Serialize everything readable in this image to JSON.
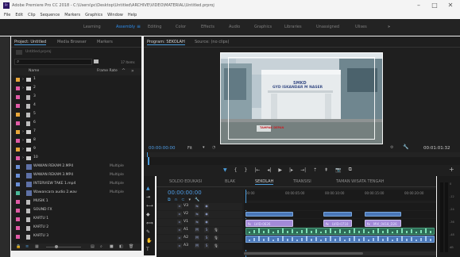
{
  "window": {
    "app_icon_label": "Pr",
    "title": "Adobe Premiere Pro CC 2018 - C:\\Users\\pc\\Desktop\\Untitled\\ARCHIVE\\VIDEO\\MATERIAL\\Untitled.prproj",
    "controls": [
      "–",
      "□",
      "✕"
    ]
  },
  "menu": [
    "File",
    "Edit",
    "Clip",
    "Sequence",
    "Markers",
    "Graphics",
    "Window",
    "Help"
  ],
  "workspaces": {
    "items": [
      "Learning",
      "Assembly",
      "Editing",
      "Color",
      "Effects",
      "Audio",
      "Graphics",
      "Libraries",
      "Unassigned",
      "Ulises"
    ],
    "active_index": 1,
    "more": "»"
  },
  "project_panel": {
    "tabs": [
      "Project: Untitled",
      "Media Browser",
      "Markers"
    ],
    "active_tab": 0,
    "path": "Untitled.prproj",
    "search_placeholder": "",
    "items_count": "17 Items",
    "columns": {
      "name": "Name",
      "frame_rate": "Frame Rate"
    },
    "rows": [
      {
        "kind": "bin",
        "color": "#e8a63a",
        "name": "1",
        "type": ""
      },
      {
        "kind": "bin",
        "color": "#e05aa6",
        "name": "2",
        "type": ""
      },
      {
        "kind": "seq",
        "color": "#e05aa6",
        "name": "3",
        "type": ""
      },
      {
        "kind": "seq",
        "color": "#e05aa6",
        "name": "4",
        "type": ""
      },
      {
        "kind": "seq",
        "color": "#e8a63a",
        "name": "5",
        "type": ""
      },
      {
        "kind": "seq",
        "color": "#e05aa6",
        "name": "6",
        "type": ""
      },
      {
        "kind": "bin",
        "color": "#e8a63a",
        "name": "7",
        "type": ""
      },
      {
        "kind": "bin",
        "color": "#e05aa6",
        "name": "8",
        "type": ""
      },
      {
        "kind": "bin",
        "color": "#e8a63a",
        "name": "9",
        "type": ""
      },
      {
        "kind": "bin",
        "color": "#e05aa6",
        "name": "10",
        "type": ""
      },
      {
        "kind": "media",
        "color": "#6a8ed6",
        "name": "WAWAN REKAM 2.MP4",
        "type": "Multiple"
      },
      {
        "kind": "media",
        "color": "#6a8ed6",
        "name": "WAWAN REKAM 3.MP4",
        "type": "Multiple"
      },
      {
        "kind": "media",
        "color": "#6a8ed6",
        "name": "INTERVIEW TAKE 1.mp4",
        "type": "Multiple"
      },
      {
        "kind": "media",
        "color": "#4ab898",
        "name": "Wawancara audio 2.wav",
        "type": "Multiple"
      },
      {
        "kind": "seq",
        "color": "#e05aa6",
        "name": "MUSIK 1",
        "type": ""
      },
      {
        "kind": "seq",
        "color": "#e05aa6",
        "name": "SOUND FX",
        "type": ""
      },
      {
        "kind": "seq",
        "color": "#e05aa6",
        "name": "KARTU 1",
        "type": ""
      },
      {
        "kind": "seq",
        "color": "#e05aa6",
        "name": "KARTU 2",
        "type": ""
      },
      {
        "kind": "seq",
        "color": "#e05aa6",
        "name": "KARTU 3",
        "type": ""
      }
    ]
  },
  "program_monitor": {
    "tabs": [
      "Program: SEKOLAH",
      "Source: (no clips)"
    ],
    "active_tab": 0,
    "timecode_current": "00:00:00:00",
    "fit": "Fit",
    "timecode_duration": "00:01:01:32",
    "sign_lines": [
      "SMKD",
      "GYD ISKANDAR M NASER"
    ],
    "caption": "TAMPAK DEPAN"
  },
  "transport_icons": [
    "marker-icon",
    "in-point-icon",
    "out-point-icon",
    "go-to-in-icon",
    "step-back-icon",
    "play-icon",
    "step-forward-icon",
    "go-to-out-icon",
    "lift-icon",
    "extract-icon",
    "export-frame-icon",
    "compare-icon"
  ],
  "timeline": {
    "tabs": [
      "SOLDO EDUKASI",
      "BLAK",
      "SEKOLAH",
      "TRANSISI",
      "TAMAN WISATA TENGAH"
    ],
    "active_tab": 2,
    "timecode": "00:00:00:00",
    "ruler": [
      "00:00",
      "00:00:05:00",
      "00:00:10:00",
      "00:00:15:00",
      "00:00:20:00"
    ],
    "tracks": [
      "V3",
      "V2",
      "V1",
      "A1",
      "A2",
      "A3"
    ],
    "clips_video": [
      {
        "label": "LVID-0626"
      },
      {
        "label": "LVID-0710"
      },
      {
        "label": "MVI_0418_D26"
      }
    ]
  },
  "tools": [
    "selection-icon",
    "track-select-icon",
    "ripple-edit-icon",
    "razor-icon",
    "slip-icon",
    "pen-icon",
    "hand-icon",
    "type-icon"
  ],
  "meters": {
    "labels": [
      "0",
      "-12",
      "-24",
      "-36",
      "-48",
      "dB"
    ]
  }
}
